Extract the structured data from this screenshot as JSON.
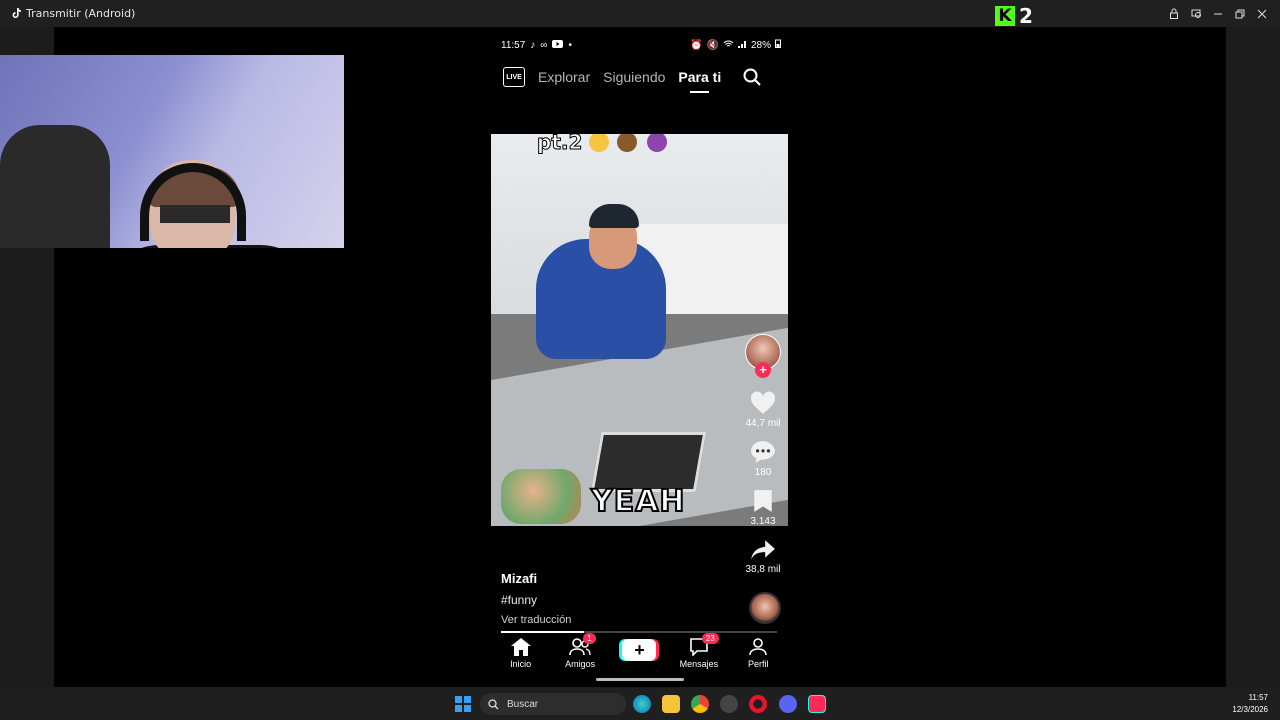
{
  "window": {
    "title": "Transmitir (Android)",
    "overlay_logo_letter": "K",
    "overlay_logo_number": "2"
  },
  "phone": {
    "status": {
      "time": "11:57",
      "battery": "28%"
    },
    "tabs": [
      {
        "label": "Explorar"
      },
      {
        "label": "Siguiendo"
      },
      {
        "label": "Para ti"
      }
    ],
    "live_label": "LIVE",
    "video": {
      "caption_top": "pt.2",
      "caption_bottom": "YEAH",
      "progress": 0.3
    },
    "rail": {
      "likes": "44,7 mil",
      "comments": "180",
      "favorites": "3.143",
      "shares": "38,8 mil"
    },
    "post": {
      "username": "Mizafi",
      "hashtag": "#funny",
      "translate": "Ver traducción"
    },
    "bottom_nav": [
      {
        "label": "Inicio"
      },
      {
        "label": "Amigos",
        "badge": "1"
      },
      {
        "label": ""
      },
      {
        "label": "Mensajes",
        "badge": "23"
      },
      {
        "label": "Perfil"
      }
    ]
  },
  "taskbar": {
    "search_placeholder": "Buscar",
    "time": "11:57",
    "date": "12/3/2026"
  },
  "colors": {
    "accent": "#fe2c55",
    "kick_green": "#53fc18",
    "tiktok_cyan": "#25f4ee"
  }
}
